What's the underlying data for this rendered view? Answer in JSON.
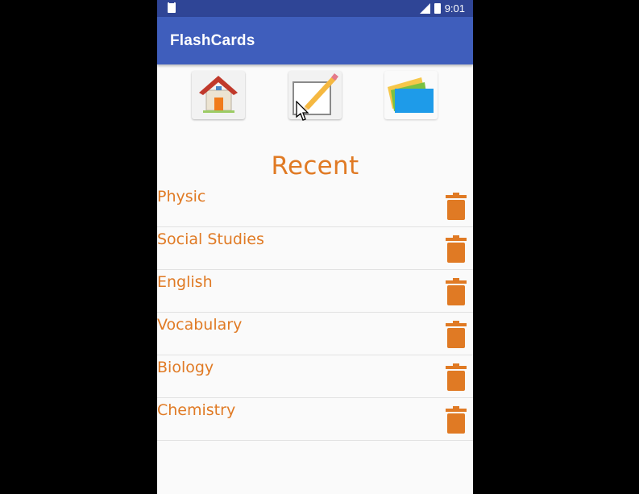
{
  "status_bar": {
    "time": "9:01"
  },
  "app_bar": {
    "title": "FlashCards"
  },
  "toolbar": {
    "buttons": [
      {
        "icon": "home-icon"
      },
      {
        "icon": "pencil-paper-icon"
      },
      {
        "icon": "cards-icon"
      }
    ]
  },
  "recent": {
    "heading": "Recent",
    "items": [
      {
        "label": "Physic"
      },
      {
        "label": "Social Studies"
      },
      {
        "label": "English"
      },
      {
        "label": "Vocabulary"
      },
      {
        "label": "Biology"
      },
      {
        "label": "Chemistry"
      }
    ]
  },
  "colors": {
    "status_bar": "#2f4596",
    "app_bar": "#3f5ebc",
    "accent_orange": "#e07a24"
  }
}
